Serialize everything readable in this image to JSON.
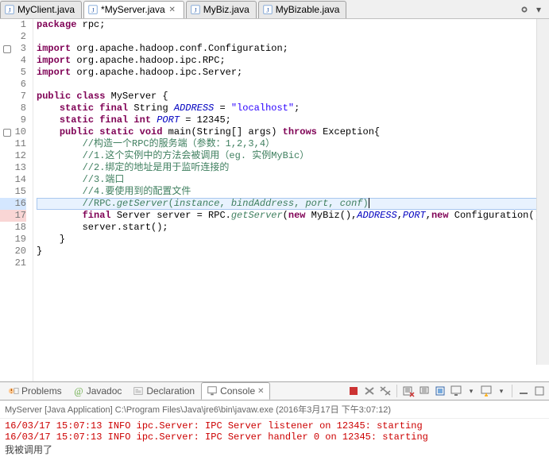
{
  "tabs": [
    {
      "label": "MyClient.java",
      "dirty": false,
      "active": false
    },
    {
      "label": "*MyServer.java",
      "dirty": true,
      "active": true
    },
    {
      "label": "MyBiz.java",
      "dirty": false,
      "active": false
    },
    {
      "label": "MyBizable.java",
      "dirty": false,
      "active": false
    }
  ],
  "code": {
    "lines": [
      {
        "n": 1,
        "seg": [
          [
            "k",
            "package"
          ],
          [
            "",
            " rpc;"
          ]
        ]
      },
      {
        "n": 2,
        "seg": []
      },
      {
        "n": 3,
        "mk": true,
        "seg": [
          [
            "k",
            "import"
          ],
          [
            "",
            " org.apache.hadoop.conf.Configuration;"
          ]
        ]
      },
      {
        "n": 4,
        "seg": [
          [
            "k",
            "import"
          ],
          [
            "",
            " org.apache.hadoop.ipc.RPC;"
          ]
        ]
      },
      {
        "n": 5,
        "seg": [
          [
            "k",
            "import"
          ],
          [
            "",
            " org.apache.hadoop.ipc.Server;"
          ]
        ]
      },
      {
        "n": 6,
        "seg": []
      },
      {
        "n": 7,
        "seg": [
          [
            "k",
            "public class"
          ],
          [
            "",
            " MyServer {"
          ]
        ]
      },
      {
        "n": 8,
        "seg": [
          [
            "",
            "    "
          ],
          [
            "k",
            "static final"
          ],
          [
            "",
            " String "
          ],
          [
            "a",
            "ADDRESS"
          ],
          [
            "",
            " = "
          ],
          [
            "s",
            "\"localhost\""
          ],
          [
            "",
            ";"
          ]
        ]
      },
      {
        "n": 9,
        "seg": [
          [
            "",
            "    "
          ],
          [
            "k",
            "static final int"
          ],
          [
            "",
            " "
          ],
          [
            "a",
            "PORT"
          ],
          [
            "",
            " = 12345;"
          ]
        ]
      },
      {
        "n": 10,
        "mk": true,
        "seg": [
          [
            "",
            "    "
          ],
          [
            "k",
            "public static void"
          ],
          [
            "",
            " main(String[] args) "
          ],
          [
            "k",
            "throws"
          ],
          [
            "",
            " Exception{"
          ]
        ]
      },
      {
        "n": 11,
        "seg": [
          [
            "",
            "        "
          ],
          [
            "c",
            "//构造一个RPC的服务端（参数：1,2,3,4）"
          ]
        ]
      },
      {
        "n": 12,
        "seg": [
          [
            "",
            "        "
          ],
          [
            "c",
            "//1.这个实例中的方法会被调用（eg. 实例MyBic）"
          ]
        ]
      },
      {
        "n": 13,
        "seg": [
          [
            "",
            "        "
          ],
          [
            "c",
            "//2.绑定的地址是用于监听连接的"
          ]
        ]
      },
      {
        "n": 14,
        "seg": [
          [
            "",
            "        "
          ],
          [
            "c",
            "//3.端口"
          ]
        ]
      },
      {
        "n": 15,
        "seg": [
          [
            "",
            "        "
          ],
          [
            "c",
            "//4.要使用到的配置文件"
          ]
        ]
      },
      {
        "n": 16,
        "hl": true,
        "seg": [
          [
            "",
            "        "
          ],
          [
            "c",
            "//RPC."
          ],
          [
            "ci",
            "getServer"
          ],
          [
            "c",
            "("
          ],
          [
            "ci",
            "instance"
          ],
          [
            "c",
            ", "
          ],
          [
            "ci",
            "bindAddress"
          ],
          [
            "c",
            ", "
          ],
          [
            "ci",
            "port"
          ],
          [
            "c",
            ", "
          ],
          [
            "ci",
            "conf"
          ],
          [
            "c",
            ")"
          ]
        ]
      },
      {
        "n": 17,
        "err": true,
        "seg": [
          [
            "",
            "        "
          ],
          [
            "k",
            "final"
          ],
          [
            "",
            " Server server = RPC."
          ],
          [
            "ci",
            "getServer"
          ],
          [
            "",
            "("
          ],
          [
            "k",
            "new"
          ],
          [
            "",
            " MyBiz(),"
          ],
          [
            "a",
            "ADDRESS"
          ],
          [
            "",
            ","
          ],
          [
            "a",
            "PORT"
          ],
          [
            "",
            ","
          ],
          [
            "k",
            "new"
          ],
          [
            "",
            " Configuration());"
          ]
        ]
      },
      {
        "n": 18,
        "seg": [
          [
            "",
            "        "
          ],
          [
            "",
            "server.start();"
          ]
        ]
      },
      {
        "n": 19,
        "seg": [
          [
            "",
            "    }"
          ]
        ]
      },
      {
        "n": 20,
        "seg": [
          [
            "",
            "}"
          ]
        ]
      },
      {
        "n": 21,
        "seg": []
      }
    ]
  },
  "views": [
    {
      "id": "problems",
      "label": "Problems",
      "active": false
    },
    {
      "id": "javadoc",
      "label": "Javadoc",
      "active": false
    },
    {
      "id": "declaration",
      "label": "Declaration",
      "active": false
    },
    {
      "id": "console",
      "label": "Console",
      "active": true
    }
  ],
  "console": {
    "header": "MyServer [Java Application] C:\\Program Files\\Java\\jre6\\bin\\javaw.exe (2016年3月17日 下午3:07:12)",
    "lines": [
      "16/03/17 15:07:13 INFO ipc.Server: IPC Server listener on 12345: starting",
      "16/03/17 15:07:13 INFO ipc.Server: IPC Server handler 0 on 12345: starting"
    ],
    "tail": "我被调用了"
  },
  "toolbar": {
    "terminate": "terminate",
    "remove": "remove-launches",
    "remove_all": "remove-all-terminated",
    "clear": "clear-console",
    "lock": "scroll-lock",
    "pin": "pin-console",
    "display": "display-selected",
    "open": "open-console",
    "min": "minimize",
    "max": "maximize"
  }
}
